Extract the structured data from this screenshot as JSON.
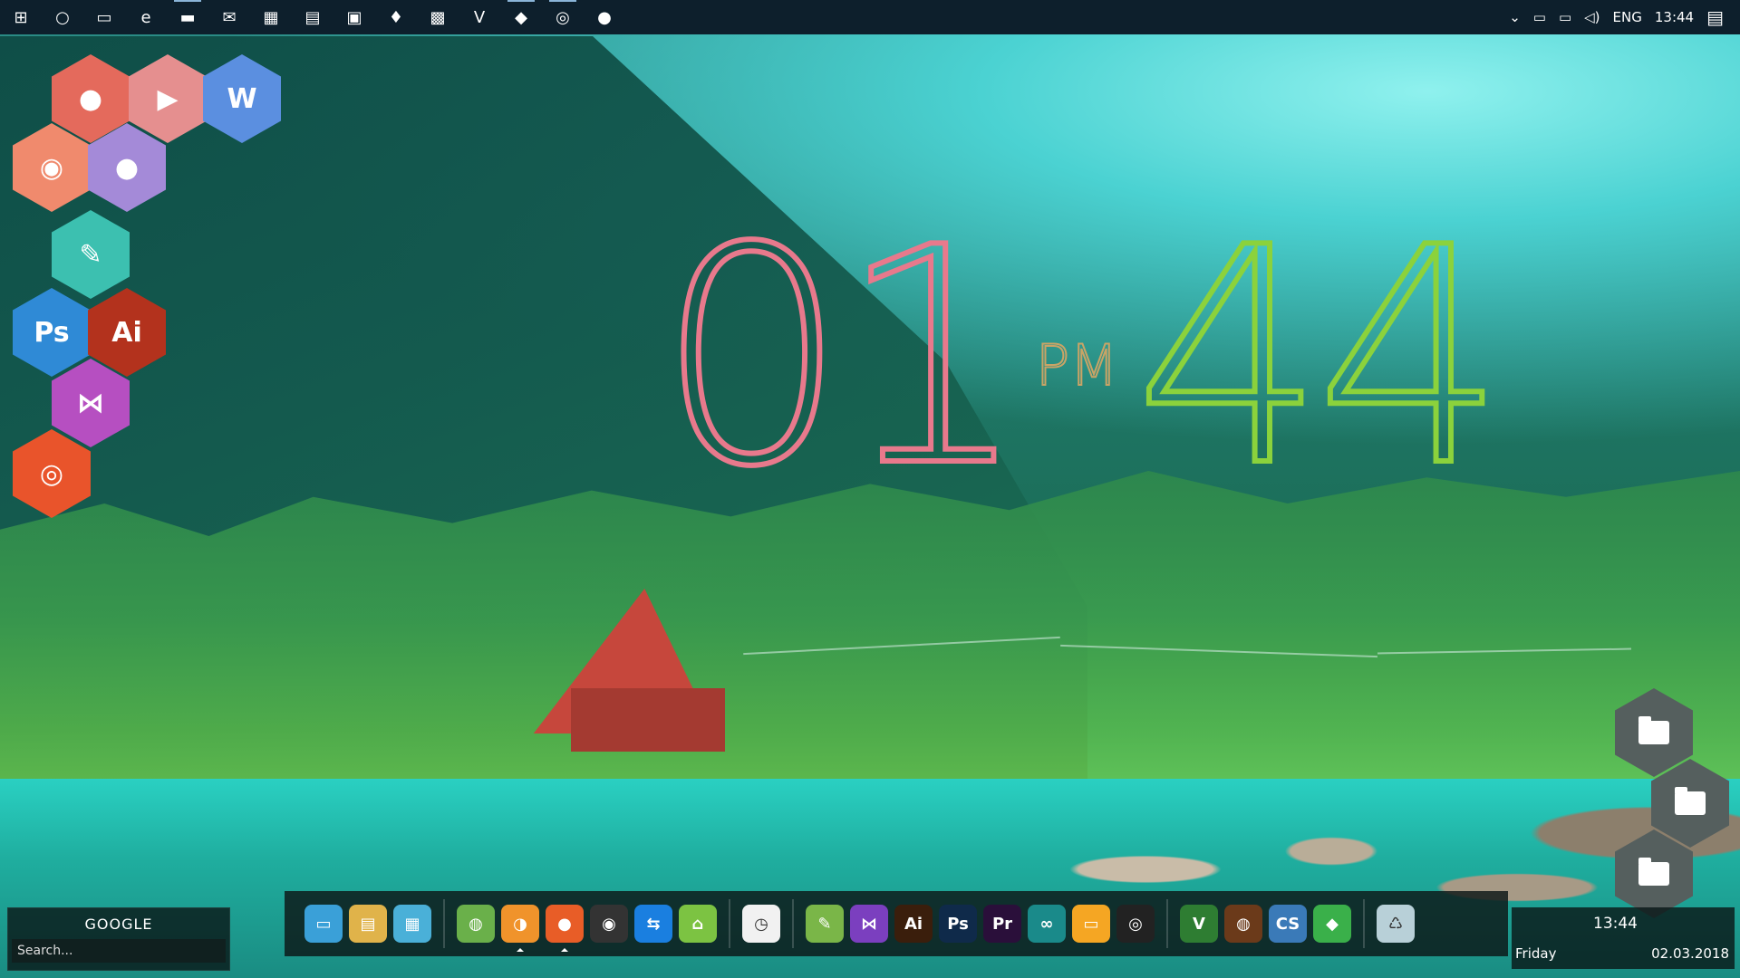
{
  "taskbar": {
    "icons": [
      {
        "name": "windows-start-icon",
        "glyph": "⊞"
      },
      {
        "name": "cortana-icon",
        "glyph": "○"
      },
      {
        "name": "task-view-icon",
        "glyph": "▭"
      },
      {
        "name": "edge-icon",
        "glyph": "e"
      },
      {
        "name": "file-explorer-icon",
        "glyph": "▬"
      },
      {
        "name": "mail-icon",
        "glyph": "✉"
      },
      {
        "name": "store-icon",
        "glyph": "▦"
      },
      {
        "name": "document-icon",
        "glyph": "▤"
      },
      {
        "name": "gift-app-icon",
        "glyph": "▣"
      },
      {
        "name": "drop-app-icon",
        "glyph": "♦"
      },
      {
        "name": "yellow-app-icon",
        "glyph": "▩"
      },
      {
        "name": "vim-icon",
        "glyph": "V"
      },
      {
        "name": "orange-app-icon",
        "glyph": "◆"
      },
      {
        "name": "obs-icon",
        "glyph": "◎"
      },
      {
        "name": "firefox-icon",
        "glyph": "●"
      }
    ],
    "tray": {
      "language": "ENG",
      "time": "13:44"
    }
  },
  "clock": {
    "hours": "01",
    "ampm": "PM",
    "minutes": "44"
  },
  "hex_launcher": [
    {
      "name": "chrome-icon",
      "label": "●",
      "color": "#e46a5c"
    },
    {
      "name": "youtube-icon",
      "label": "▶",
      "color": "#e58f8f"
    },
    {
      "name": "word-icon",
      "label": "W",
      "color": "#5b8fe0"
    },
    {
      "name": "firefox-icon",
      "label": "◉",
      "color": "#f08a6d"
    },
    {
      "name": "tor-icon",
      "label": "●",
      "color": "#a48ad8"
    },
    {
      "name": "notes-icon",
      "label": "✎",
      "color": "#3cc0b0"
    },
    {
      "name": "photoshop-icon",
      "label": "Ps",
      "color": "#2f8ad6"
    },
    {
      "name": "illustrator-icon",
      "label": "Ai",
      "color": "#b3321d"
    },
    {
      "name": "visual-studio-icon",
      "label": "⋈",
      "color": "#b64fc1"
    },
    {
      "name": "ubuntu-icon",
      "label": "◎",
      "color": "#e9542b"
    }
  ],
  "google_widget": {
    "title": "GOOGLE",
    "placeholder": "Search..."
  },
  "dock": {
    "groups": [
      [
        {
          "name": "computer-icon",
          "label": "▭",
          "bg": "#3aa0d8"
        },
        {
          "name": "user-folder-icon",
          "label": "▤",
          "bg": "#e0b34a"
        },
        {
          "name": "control-panel-icon",
          "label": "▦",
          "bg": "#4ab0d8"
        }
      ],
      [
        {
          "name": "globe-icon",
          "label": "◍",
          "bg": "#6ab04a"
        },
        {
          "name": "uc-browser-icon",
          "label": "◑",
          "bg": "#f0932b",
          "running": true
        },
        {
          "name": "firefox-icon",
          "label": "●",
          "bg": "#e85d27",
          "running": true
        },
        {
          "name": "deepin-icon",
          "label": "◉",
          "bg": "#333"
        },
        {
          "name": "teamviewer-icon",
          "label": "⇆",
          "bg": "#1a7fe0"
        },
        {
          "name": "vpn-icon",
          "label": "⌂",
          "bg": "#7cc342"
        }
      ],
      [
        {
          "name": "clock-app-icon",
          "label": "◷",
          "bg": "#f1f1f1"
        }
      ],
      [
        {
          "name": "notes-app-icon",
          "label": "✎",
          "bg": "#7ab648"
        },
        {
          "name": "visual-studio-icon",
          "label": "⋈",
          "bg": "#7b3fbf"
        },
        {
          "name": "illustrator-icon",
          "label": "Ai",
          "bg": "#3a1e0c"
        },
        {
          "name": "photoshop-icon",
          "label": "Ps",
          "bg": "#0f2a4a"
        },
        {
          "name": "premiere-icon",
          "label": "Pr",
          "bg": "#2a0f3a"
        },
        {
          "name": "arduino-icon",
          "label": "∞",
          "bg": "#1a8a8a"
        },
        {
          "name": "notepad-icon",
          "label": "▭",
          "bg": "#f5a623"
        },
        {
          "name": "obs-icon",
          "label": "◎",
          "bg": "#222"
        }
      ],
      [
        {
          "name": "vim-icon",
          "label": "V",
          "bg": "#2e7d32"
        },
        {
          "name": "game-icon",
          "label": "◍",
          "bg": "#6b3a1a"
        },
        {
          "name": "cities-skylines-icon",
          "label": "CS",
          "bg": "#3a7ab8"
        },
        {
          "name": "bluestacks-icon",
          "label": "◆",
          "bg": "#3ab04a"
        }
      ],
      [
        {
          "name": "recycle-bin-icon",
          "label": "♺",
          "bg": "#b8d0d8"
        }
      ]
    ]
  },
  "clock_widget": {
    "time": "13:44",
    "day": "Friday",
    "date": "02.03.2018"
  }
}
